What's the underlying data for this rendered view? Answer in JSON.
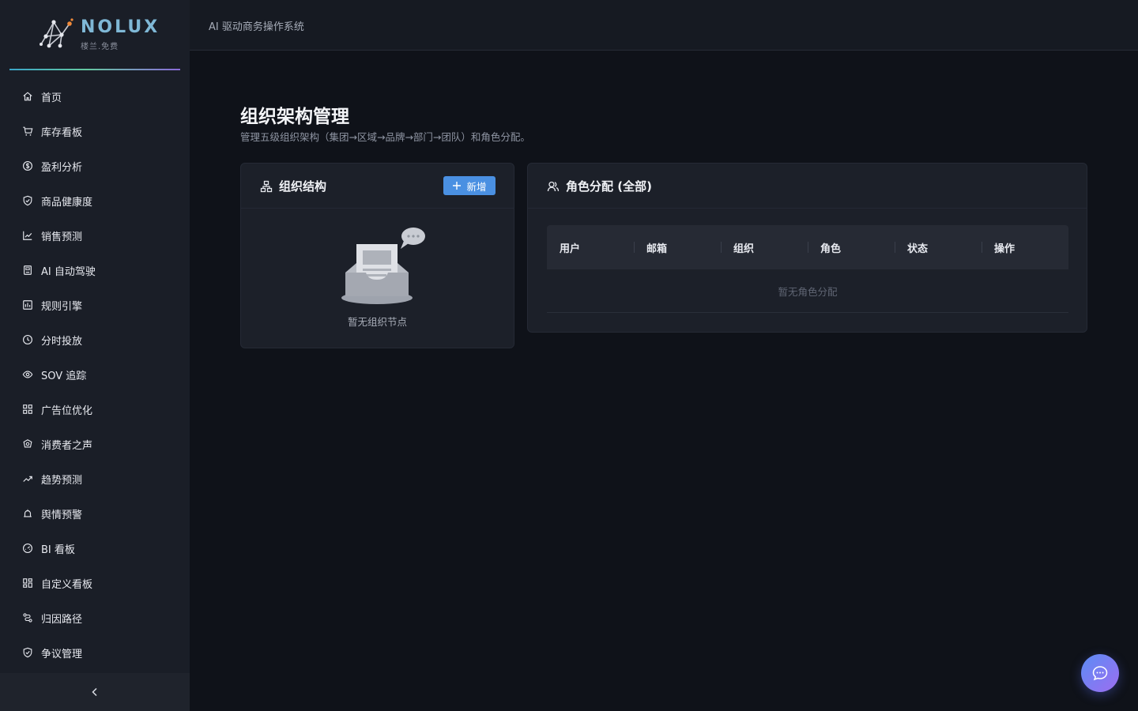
{
  "brand": {
    "name": "NOLUX",
    "subtitle": "楼兰.免费",
    "accent_gradient": [
      "#3aa5c8",
      "#64c8a0",
      "#8a6ad8"
    ]
  },
  "topbar": {
    "title": "AI 驱动商务操作系统"
  },
  "sidebar": {
    "items": [
      {
        "label": "首页",
        "icon": "home-icon"
      },
      {
        "label": "库存看板",
        "icon": "cart-icon"
      },
      {
        "label": "盈利分析",
        "icon": "dollar-circle-icon"
      },
      {
        "label": "商品健康度",
        "icon": "shield-check-icon"
      },
      {
        "label": "销售预测",
        "icon": "line-chart-icon"
      },
      {
        "label": "AI 自动驾驶",
        "icon": "robot-icon"
      },
      {
        "label": "规则引擎",
        "icon": "rules-icon"
      },
      {
        "label": "分时投放",
        "icon": "clock-icon"
      },
      {
        "label": "SOV 追踪",
        "icon": "eye-icon"
      },
      {
        "label": "广告位优化",
        "icon": "grid-icon"
      },
      {
        "label": "消费者之声",
        "icon": "voice-icon"
      },
      {
        "label": "趋势预测",
        "icon": "trend-icon"
      },
      {
        "label": "舆情预警",
        "icon": "alarm-icon"
      },
      {
        "label": "BI 看板",
        "icon": "dashboard-icon"
      },
      {
        "label": "自定义看板",
        "icon": "custom-grid-icon"
      },
      {
        "label": "归因路径",
        "icon": "path-icon"
      },
      {
        "label": "争议管理",
        "icon": "shield-icon"
      }
    ],
    "collapse_icon": "chevron-left-icon"
  },
  "page": {
    "title": "组织架构管理",
    "subtitle": "管理五级组织架构（集团→区域→品牌→部门→团队）和角色分配。"
  },
  "org_card": {
    "title": "组织结构",
    "add_label": "新增",
    "empty_text": "暂无组织节点",
    "icon": "org-tree-icon"
  },
  "role_card": {
    "title": "角色分配 (全部)",
    "icon": "users-icon",
    "columns": [
      "用户",
      "邮箱",
      "组织",
      "角色",
      "状态",
      "操作"
    ],
    "empty_text": "暂无角色分配"
  },
  "fab": {
    "icon": "chat-icon",
    "gradient": [
      "#5b8df5",
      "#9d6df0"
    ]
  }
}
